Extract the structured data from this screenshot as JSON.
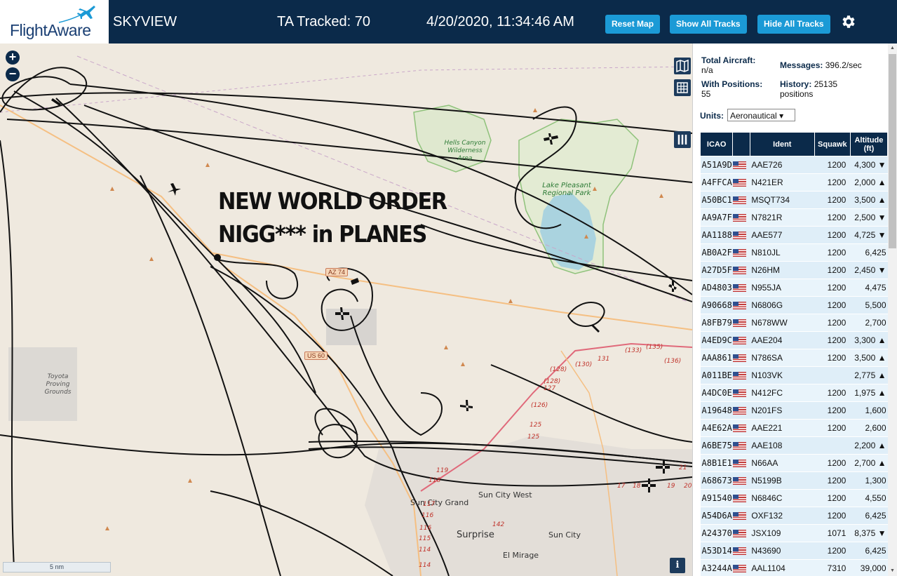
{
  "header": {
    "logo_text": "FlightAware",
    "app_name": "SKYVIEW",
    "tracked": "TA Tracked: 70",
    "datetime": "4/20/2020, 11:34:46 AM",
    "buttons": {
      "reset": "Reset Map",
      "show_all": "Show All Tracks",
      "hide_all": "Hide All Tracks"
    },
    "settings_icon": "gear-icon"
  },
  "map": {
    "zoom_in": "+",
    "zoom_out": "−",
    "overlay_text_line1": "NEW WORLD ORDER",
    "overlay_text_line2": "NIGG*** in PLANES",
    "scale": "5 nm",
    "info": "i",
    "labels": {
      "hells_canyon": "Hells Canyon Wilderness Area",
      "lake_pleasant": "Lake Pleasant Regional Park",
      "toyota": "Toyota Proving Grounds",
      "sun_city_grand": "Sun City Grand",
      "sun_city_west": "Sun City West",
      "surprise": "Surprise",
      "sun_city": "Sun City",
      "el_mirage": "El Mirage",
      "az74": "AZ 74",
      "us60": "US 60"
    },
    "route_labels": [
      "(128)",
      "(128)",
      "127",
      "(130)",
      "131",
      "(133)",
      "(135)",
      "(136)",
      "(126)",
      "125",
      "125",
      "119",
      "118",
      "117",
      "116",
      "116",
      "115",
      "114",
      "114",
      "142",
      "17",
      "18",
      "19",
      "20",
      "21"
    ]
  },
  "panel": {
    "total_label": "Total Aircraft:",
    "total_value": "n/a",
    "messages_label": "Messages:",
    "messages_value": "396.2/sec",
    "positions_label": "With Positions:",
    "positions_value": "55",
    "history_label": "History:",
    "history_value": "25135 positions",
    "units_label": "Units:",
    "units_value": "Aeronautical",
    "columns": [
      "ICAO",
      "",
      "Ident",
      "Squawk",
      "Altitude (ft)"
    ],
    "rows": [
      {
        "icao": "A51A9D",
        "ident": "AAE726",
        "squawk": "1200",
        "alt": "4,300 ▼"
      },
      {
        "icao": "A4FFCA",
        "ident": "N421ER",
        "squawk": "1200",
        "alt": "2,000 ▲"
      },
      {
        "icao": "A50BC1",
        "ident": "MSQT734",
        "squawk": "1200",
        "alt": "3,500 ▲"
      },
      {
        "icao": "AA9A7F",
        "ident": "N7821R",
        "squawk": "1200",
        "alt": "2,500 ▼"
      },
      {
        "icao": "AA1188",
        "ident": "AAE577",
        "squawk": "1200",
        "alt": "4,725 ▼"
      },
      {
        "icao": "AB0A2F",
        "ident": "N810JL",
        "squawk": "1200",
        "alt": "6,425"
      },
      {
        "icao": "A27D5F",
        "ident": "N26HM",
        "squawk": "1200",
        "alt": "2,450 ▼"
      },
      {
        "icao": "AD4803",
        "ident": "N955JA",
        "squawk": "1200",
        "alt": "4,475"
      },
      {
        "icao": "A90668",
        "ident": "N6806G",
        "squawk": "1200",
        "alt": "5,500"
      },
      {
        "icao": "A8FB79",
        "ident": "N678WW",
        "squawk": "1200",
        "alt": "2,700"
      },
      {
        "icao": "A4ED9C",
        "ident": "AAE204",
        "squawk": "1200",
        "alt": "3,300 ▲"
      },
      {
        "icao": "AAA861",
        "ident": "N786SA",
        "squawk": "1200",
        "alt": "3,500 ▲"
      },
      {
        "icao": "A011BE",
        "ident": "N103VK",
        "squawk": "",
        "alt": "2,775 ▲"
      },
      {
        "icao": "A4DC0E",
        "ident": "N412FC",
        "squawk": "1200",
        "alt": "1,975 ▲"
      },
      {
        "icao": "A19648",
        "ident": "N201FS",
        "squawk": "1200",
        "alt": "1,600"
      },
      {
        "icao": "A4E62A",
        "ident": "AAE221",
        "squawk": "1200",
        "alt": "2,600"
      },
      {
        "icao": "A6BE75",
        "ident": "AAE108",
        "squawk": "",
        "alt": "2,200 ▲"
      },
      {
        "icao": "A8B1E1",
        "ident": "N66AA",
        "squawk": "1200",
        "alt": "2,700 ▲"
      },
      {
        "icao": "A68673",
        "ident": "N5199B",
        "squawk": "1200",
        "alt": "1,300"
      },
      {
        "icao": "A91540",
        "ident": "N6846C",
        "squawk": "1200",
        "alt": "4,550"
      },
      {
        "icao": "A54D6A",
        "ident": "OXF132",
        "squawk": "1200",
        "alt": "6,425"
      },
      {
        "icao": "A24370",
        "ident": "JSX109",
        "squawk": "1071",
        "alt": "8,375 ▼"
      },
      {
        "icao": "A53D14",
        "ident": "N43690",
        "squawk": "1200",
        "alt": "6,425"
      },
      {
        "icao": "A3244A",
        "ident": "AAL1104",
        "squawk": "7310",
        "alt": "39,000"
      }
    ]
  },
  "colors": {
    "header_bg": "#0b2a4a",
    "button_bg": "#1b9ad6",
    "table_header": "#0b2a4a",
    "row_a": "#dfeef8",
    "row_b": "#e9f4fb"
  }
}
